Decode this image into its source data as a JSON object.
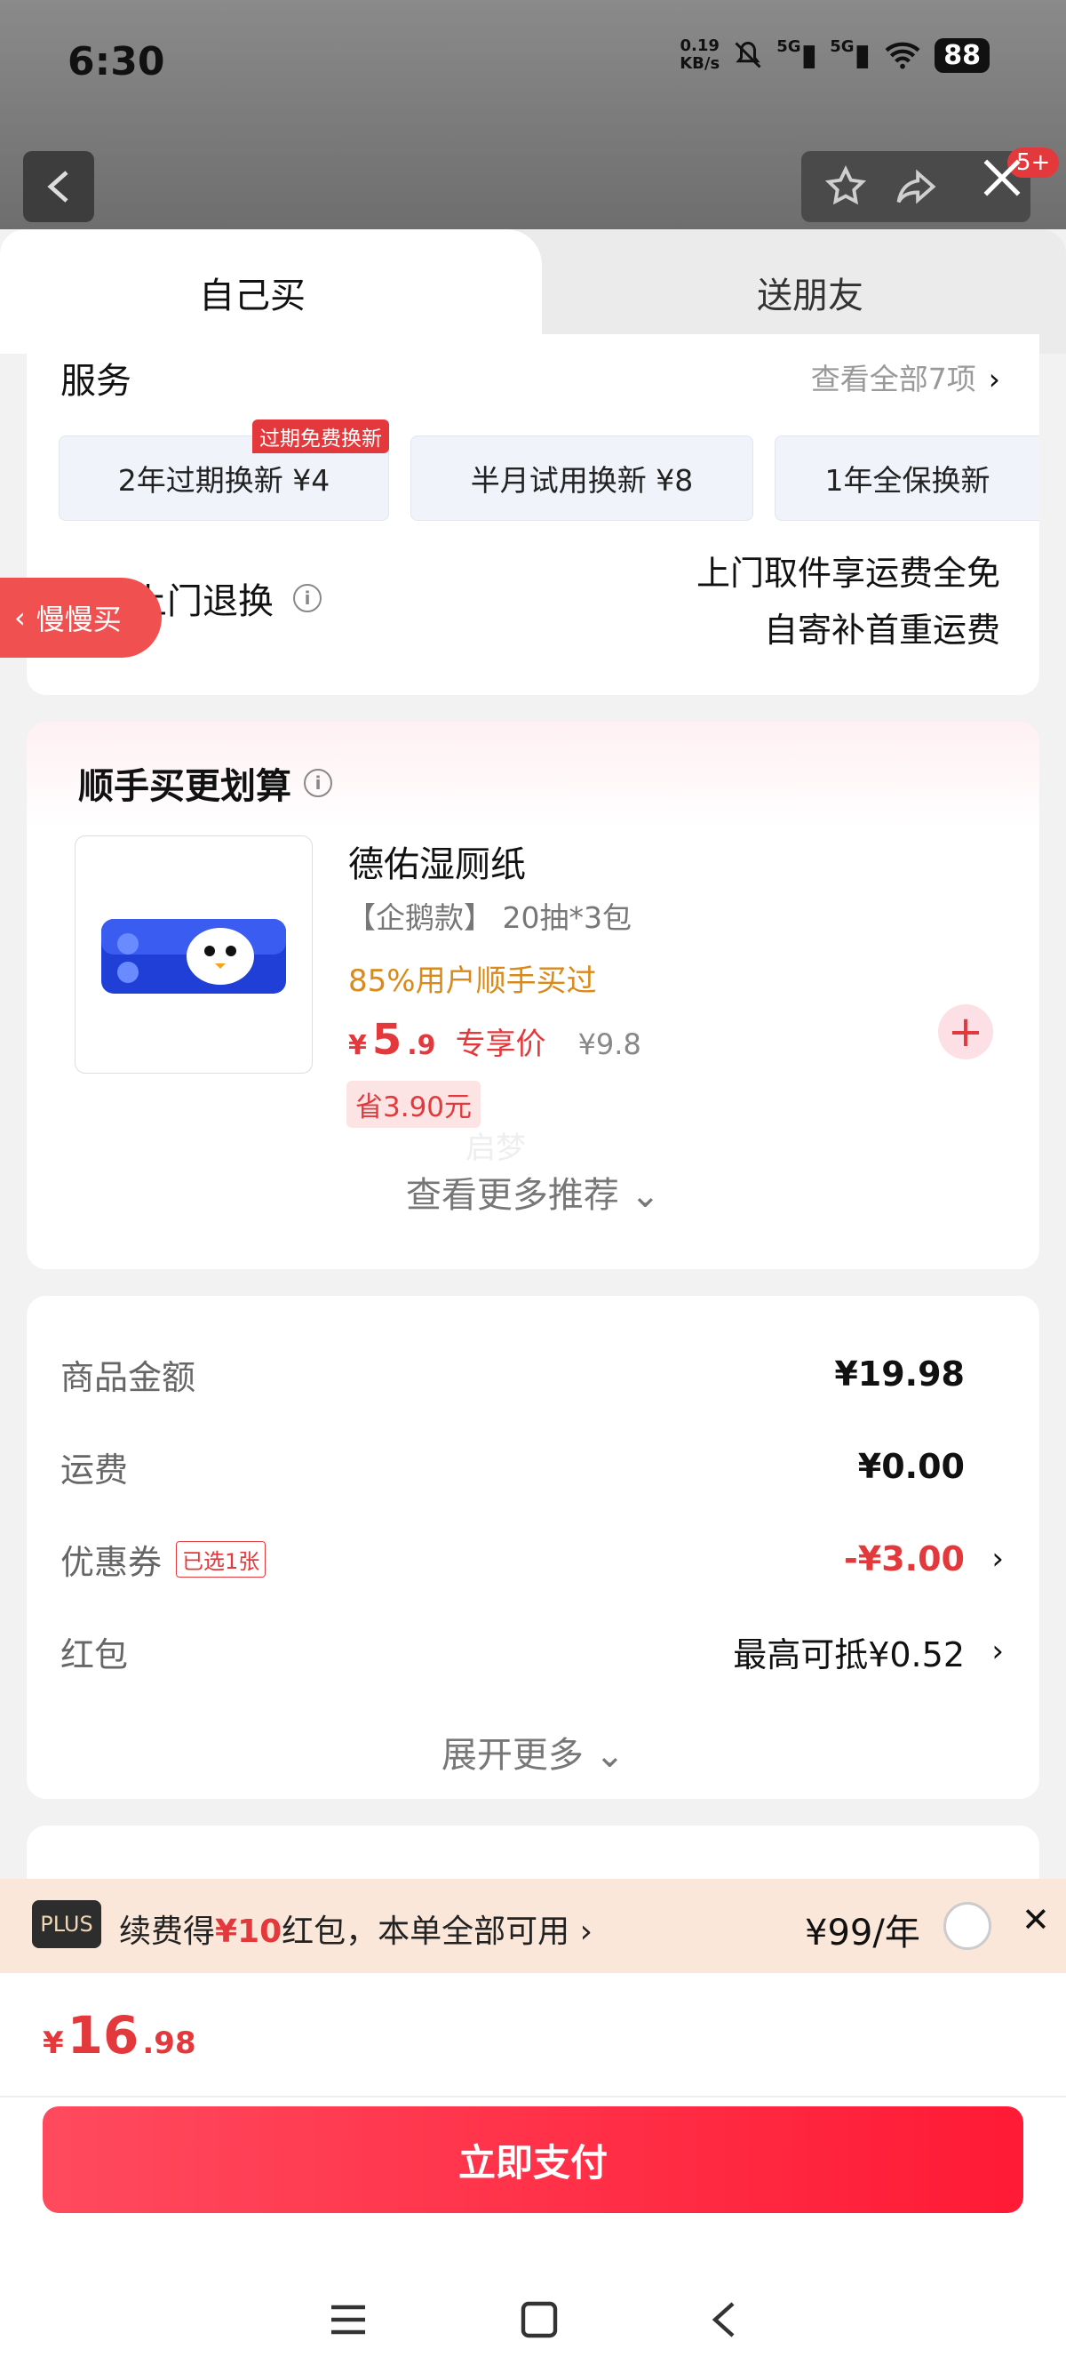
{
  "status_bar": {
    "time": "6:30",
    "net_speed_value": "0.19",
    "net_speed_unit": "KB/s",
    "signal_1": "5G",
    "signal_2": "5G",
    "battery": "88"
  },
  "header": {
    "badge": "5+"
  },
  "tabs": {
    "self": "自己买",
    "friend": "送朋友"
  },
  "service": {
    "title": "服务",
    "view_all": "查看全部7项",
    "options": [
      "2年过期换新 ¥4",
      "半月试用换新 ¥8",
      "1年全保换新"
    ],
    "hot_tag": "过期免费换新",
    "free_return": "免费上门退换",
    "return_line1": "上门取件享运费全免",
    "return_line2": "自寄补首重运费"
  },
  "combo": {
    "title": "顺手买更划算",
    "slow_buy": "慢慢买",
    "product": {
      "name": "德佑湿厕纸",
      "spec": "【企鹅款】 20抽*3包",
      "bought": "85%用户顺手买过",
      "price_currency": "¥",
      "price_int": "5",
      "price_dec": ".9",
      "price_label": "专享价",
      "orig_price": "¥9.8",
      "save": "省3.90元"
    },
    "watermark": "启梦",
    "more": "查看更多推荐 ⌄"
  },
  "amounts": {
    "goods_label": "商品金额",
    "goods_value": "¥19.98",
    "ship_label": "运费",
    "ship_value": "¥0.00",
    "coupon_label": "优惠券",
    "coupon_tag": "已选1张",
    "coupon_value": "-¥3.00",
    "redpack_label": "红包",
    "redpack_value": "最高可抵¥0.52",
    "expand": "展开更多 ⌄"
  },
  "plus": {
    "logo": "PLUS",
    "text_pre": "续费得",
    "text_amount": "¥10",
    "text_post": "红包，本单全部可用 ›",
    "price": "¥99/年"
  },
  "total": {
    "currency": "¥",
    "int": "16",
    "dec": ".98"
  },
  "pay_button": "立即支付",
  "colors": {
    "accent": "#e4393c",
    "pay_start": "#ff4a5e",
    "pay_end": "#ff1a35",
    "plus_bg": "#fbe7d9"
  }
}
